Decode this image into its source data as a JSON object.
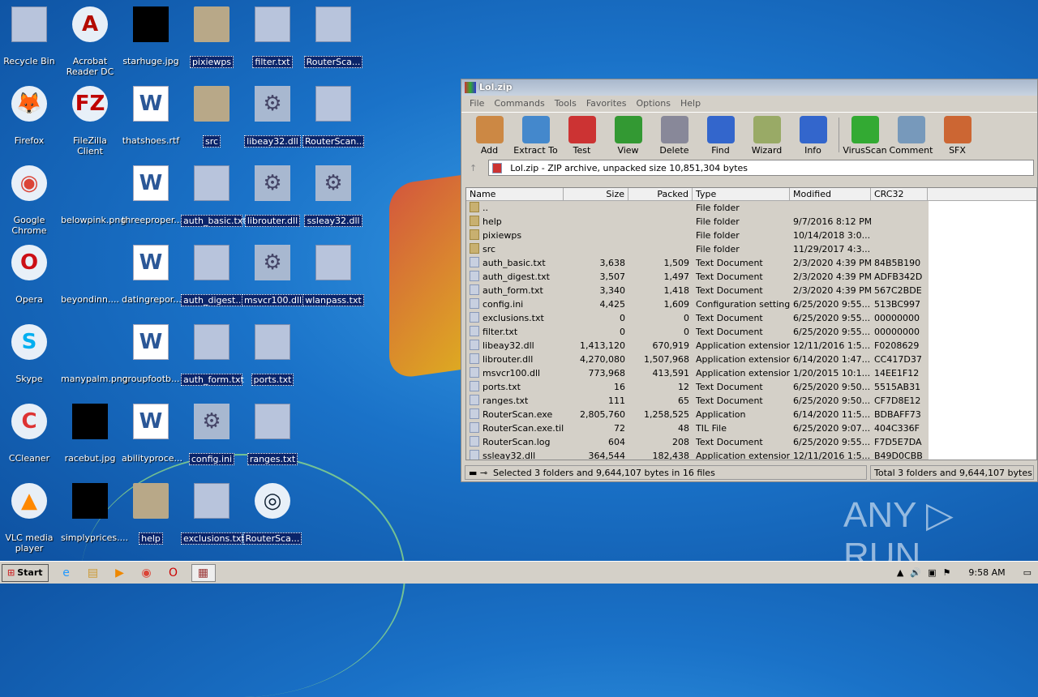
{
  "desktop_icons": [
    {
      "label": "Recycle Bin",
      "kind": "file",
      "glyph": "🗑",
      "sel": false
    },
    {
      "label": "Firefox",
      "kind": "app",
      "glyph": "🦊",
      "color": "#e66000",
      "sel": false
    },
    {
      "label": "Google Chrome",
      "kind": "app",
      "glyph": "◉",
      "color": "#db4437",
      "sel": false
    },
    {
      "label": "Opera",
      "kind": "app",
      "glyph": "O",
      "color": "#cc0f16",
      "sel": false
    },
    {
      "label": "Skype",
      "kind": "app",
      "glyph": "S",
      "color": "#00aff0",
      "sel": false
    },
    {
      "label": "CCleaner",
      "kind": "app",
      "glyph": "C",
      "color": "#d33",
      "sel": false
    },
    {
      "label": "VLC media player",
      "kind": "app",
      "glyph": "▲",
      "color": "#f80",
      "sel": false
    },
    {
      "label": "Acrobat Reader DC",
      "kind": "app",
      "glyph": "A",
      "color": "#b30b00",
      "sel": false
    },
    {
      "label": "FileZilla Client",
      "kind": "app",
      "glyph": "FZ",
      "color": "#bf0000",
      "sel": false
    },
    {
      "label": "belowpink.png",
      "kind": "none",
      "sel": false
    },
    {
      "label": "beyondinn....",
      "kind": "none",
      "sel": false
    },
    {
      "label": "manypalm.png",
      "kind": "none",
      "sel": false
    },
    {
      "label": "racebut.jpg",
      "kind": "black",
      "sel": false
    },
    {
      "label": "simplyprices....",
      "kind": "black",
      "sel": false
    },
    {
      "label": "starhuge.jpg",
      "kind": "black",
      "sel": false
    },
    {
      "label": "thatshoes.rtf",
      "kind": "doc",
      "sel": false
    },
    {
      "label": "threeproper...",
      "kind": "doc",
      "sel": false
    },
    {
      "label": "datingrepor...",
      "kind": "doc",
      "sel": false
    },
    {
      "label": "groupfootb...",
      "kind": "doc",
      "sel": false
    },
    {
      "label": "abilityproce...",
      "kind": "doc",
      "sel": false
    },
    {
      "label": "help",
      "kind": "folder",
      "sel": true
    },
    {
      "label": "pixiewps",
      "kind": "folder",
      "sel": true
    },
    {
      "label": "src",
      "kind": "folder",
      "sel": true
    },
    {
      "label": "auth_basic.txt",
      "kind": "file",
      "sel": true
    },
    {
      "label": "auth_digest...",
      "kind": "file",
      "sel": true
    },
    {
      "label": "auth_form.txt",
      "kind": "file",
      "sel": true
    },
    {
      "label": "config.ini",
      "kind": "gear",
      "sel": true
    },
    {
      "label": "exclusions.txt",
      "kind": "file",
      "sel": true
    },
    {
      "label": "filter.txt",
      "kind": "file",
      "sel": true
    },
    {
      "label": "libeay32.dll",
      "kind": "gear",
      "sel": true
    },
    {
      "label": "librouter.dll",
      "kind": "gear",
      "sel": true
    },
    {
      "label": "msvcr100.dll",
      "kind": "gear",
      "sel": true
    },
    {
      "label": "ports.txt",
      "kind": "file",
      "sel": true
    },
    {
      "label": "ranges.txt",
      "kind": "file",
      "sel": true
    },
    {
      "label": "RouterSca...",
      "kind": "app",
      "glyph": "◎",
      "color": "#123",
      "sel": true
    },
    {
      "label": "RouterSca...",
      "kind": "file",
      "sel": true
    },
    {
      "label": "RouterScan...",
      "kind": "file",
      "sel": true
    },
    {
      "label": "ssleay32.dll",
      "kind": "gear",
      "sel": true
    },
    {
      "label": "wlanpass.txt",
      "kind": "file",
      "sel": true
    }
  ],
  "window": {
    "title": "Lol.zip",
    "menu": [
      "File",
      "Commands",
      "Tools",
      "Favorites",
      "Options",
      "Help"
    ],
    "toolbar": [
      {
        "label": "Add",
        "color": "#c84"
      },
      {
        "label": "Extract To",
        "color": "#48c"
      },
      {
        "label": "Test",
        "color": "#c33"
      },
      {
        "label": "View",
        "color": "#393"
      },
      {
        "label": "Delete",
        "color": "#889"
      },
      {
        "label": "Find",
        "color": "#36c"
      },
      {
        "label": "Wizard",
        "color": "#9a6"
      },
      {
        "label": "Info",
        "color": "#36c"
      },
      {
        "label": "VirusScan",
        "color": "#3a3"
      },
      {
        "label": "Comment",
        "color": "#79b"
      },
      {
        "label": "SFX",
        "color": "#c63"
      }
    ],
    "address": "Lol.zip - ZIP archive, unpacked size 10,851,304 bytes",
    "columns": [
      "Name",
      "Size",
      "Packed",
      "Type",
      "Modified",
      "CRC32"
    ],
    "rows": [
      [
        "..",
        "",
        "",
        "File folder",
        "",
        ""
      ],
      [
        "help",
        "",
        "",
        "File folder",
        "9/7/2016 8:12 PM",
        ""
      ],
      [
        "pixiewps",
        "",
        "",
        "File folder",
        "10/14/2018 3:0...",
        ""
      ],
      [
        "src",
        "",
        "",
        "File folder",
        "11/29/2017 4:3...",
        ""
      ],
      [
        "auth_basic.txt",
        "3,638",
        "1,509",
        "Text Document",
        "2/3/2020 4:39 PM",
        "84B5B190"
      ],
      [
        "auth_digest.txt",
        "3,507",
        "1,497",
        "Text Document",
        "2/3/2020 4:39 PM",
        "ADFB342D"
      ],
      [
        "auth_form.txt",
        "3,340",
        "1,418",
        "Text Document",
        "2/3/2020 4:39 PM",
        "567C2BDE"
      ],
      [
        "config.ini",
        "4,425",
        "1,609",
        "Configuration settings",
        "6/25/2020 9:55...",
        "513BC997"
      ],
      [
        "exclusions.txt",
        "0",
        "0",
        "Text Document",
        "6/25/2020 9:55...",
        "00000000"
      ],
      [
        "filter.txt",
        "0",
        "0",
        "Text Document",
        "6/25/2020 9:55...",
        "00000000"
      ],
      [
        "libeay32.dll",
        "1,413,120",
        "670,919",
        "Application extension",
        "12/11/2016 1:5...",
        "F0208629"
      ],
      [
        "librouter.dll",
        "4,270,080",
        "1,507,968",
        "Application extension",
        "6/14/2020 1:47...",
        "CC417D37"
      ],
      [
        "msvcr100.dll",
        "773,968",
        "413,591",
        "Application extension",
        "1/20/2015 10:1...",
        "14EE1F12"
      ],
      [
        "ports.txt",
        "16",
        "12",
        "Text Document",
        "6/25/2020 9:50...",
        "5515AB31"
      ],
      [
        "ranges.txt",
        "111",
        "65",
        "Text Document",
        "6/25/2020 9:50...",
        "CF7D8E12"
      ],
      [
        "RouterScan.exe",
        "2,805,760",
        "1,258,525",
        "Application",
        "6/14/2020 11:5...",
        "BDBAFF73"
      ],
      [
        "RouterScan.exe.til",
        "72",
        "48",
        "TIL File",
        "6/25/2020 9:07...",
        "404C336F"
      ],
      [
        "RouterScan.log",
        "604",
        "208",
        "Text Document",
        "6/25/2020 9:55...",
        "F7D5E7DA"
      ],
      [
        "ssleay32.dll",
        "364,544",
        "182,438",
        "Application extension",
        "12/11/2016 1:5...",
        "B49D0CBB"
      ]
    ],
    "status_left": "Selected 3 folders and 9,644,107 bytes in 16 files",
    "status_right": "Total 3 folders and 9,644,107 bytes in 16 files"
  },
  "taskbar": {
    "start": "Start",
    "clock": "9:58 AM"
  },
  "watermark": "ANY ▷ RUN"
}
